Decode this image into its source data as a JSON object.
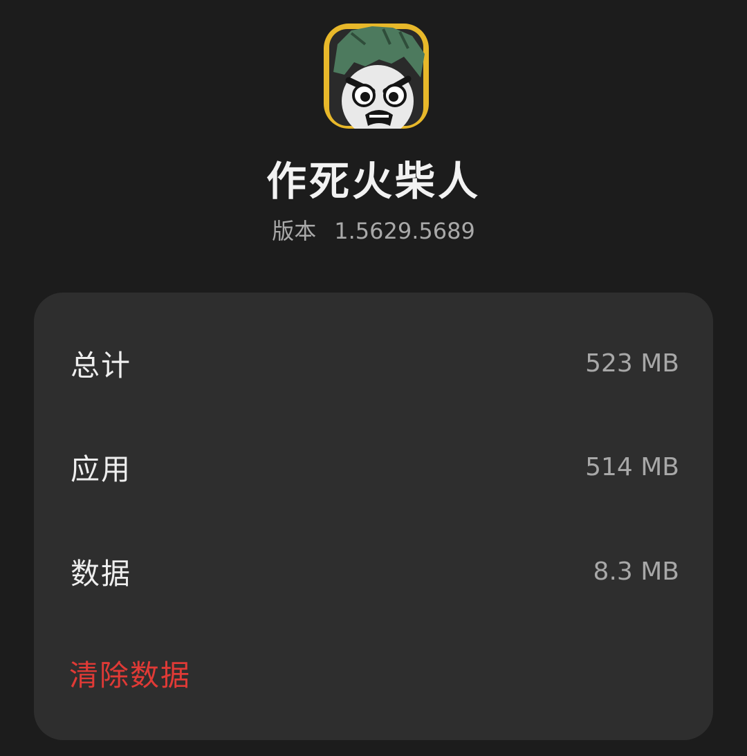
{
  "app": {
    "icon": "angry-stickman-face-icon",
    "name": "作死火柴人",
    "version_label": "版本",
    "version_value": "1.5629.5689"
  },
  "storage": {
    "items": [
      {
        "label": "总计",
        "value": "523 MB"
      },
      {
        "label": "应用",
        "value": "514 MB"
      },
      {
        "label": "数据",
        "value": "8.3 MB"
      }
    ],
    "clear_button": "清除数据"
  },
  "colors": {
    "background": "#1c1c1c",
    "card": "#2e2e2e",
    "danger": "#e03a36",
    "icon_frame": "#e8b82a",
    "icon_hair": "#4d7a5e"
  }
}
